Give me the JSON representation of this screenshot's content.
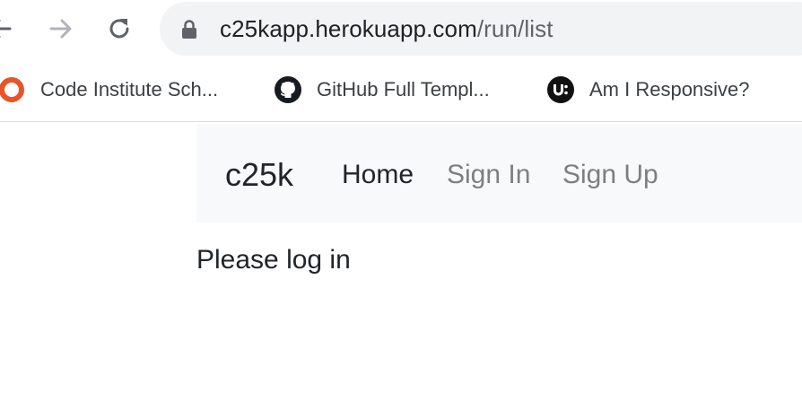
{
  "browser": {
    "url_host": "c25kapp.herokuapp.com",
    "url_path": "/run/list",
    "icons": [
      "back-arrow-icon",
      "forward-arrow-icon",
      "reload-icon",
      "lock-icon"
    ]
  },
  "bookmarks": [
    {
      "label": "Code Institute Sch...",
      "icon": "code-institute-icon"
    },
    {
      "label": "GitHub Full Templ...",
      "icon": "github-icon"
    },
    {
      "label": "Am I Responsive?",
      "icon": "am-i-responsive-icon"
    }
  ],
  "navbar": {
    "brand": "c25k",
    "links": [
      {
        "label": "Home",
        "state": "active"
      },
      {
        "label": "Sign In",
        "state": "inactive"
      },
      {
        "label": "Sign Up",
        "state": "inactive"
      }
    ]
  },
  "main": {
    "message": "Please log in"
  },
  "colors": {
    "navbar_bg": "#f8f9fa",
    "omnibox_bg": "#f1f3f4",
    "code_institute_accent": "#e8542a"
  }
}
